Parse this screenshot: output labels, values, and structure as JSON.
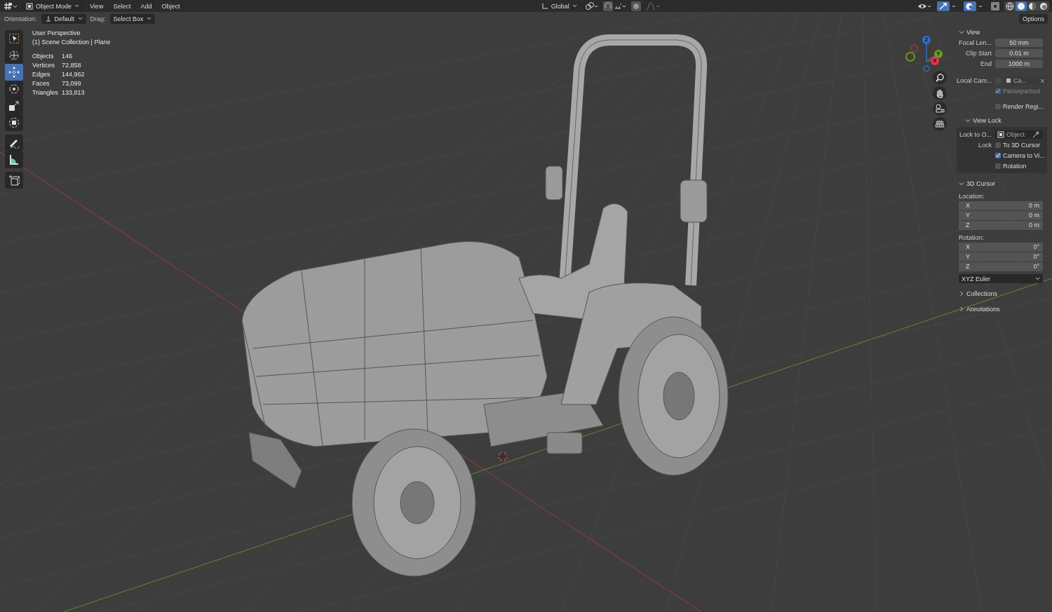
{
  "header": {
    "mode": "Object Mode",
    "menus": [
      "View",
      "Select",
      "Add",
      "Object"
    ],
    "transform_orientation": "Global",
    "shading": [
      {
        "kind": "wireframe",
        "selected": false
      },
      {
        "kind": "solid",
        "selected": true
      },
      {
        "kind": "material",
        "selected": false
      },
      {
        "kind": "rendered",
        "selected": false
      }
    ]
  },
  "tool_settings": {
    "orientation_label": "Orientation:",
    "orientation": "Default",
    "drag_label": "Drag:",
    "drag": "Select Box",
    "options": "Options"
  },
  "toolbar": [
    {
      "kind": "select-box",
      "selected": false
    },
    {
      "kind": "cursor",
      "selected": false
    },
    {
      "kind": "move",
      "selected": true
    },
    {
      "kind": "rotate",
      "selected": false
    },
    {
      "kind": "scale",
      "selected": false
    },
    {
      "kind": "transform",
      "selected": false
    },
    {
      "kind": "annotate",
      "selected": false
    },
    {
      "kind": "measure",
      "selected": false
    },
    {
      "kind": "add-cube",
      "selected": false
    }
  ],
  "viewport_info": {
    "view_name": "User Perspective",
    "collection": "(1) Scene Collection | Plane",
    "stats": [
      {
        "label": "Objects",
        "value": "146"
      },
      {
        "label": "Vertices",
        "value": "72,858"
      },
      {
        "label": "Edges",
        "value": "144,962"
      },
      {
        "label": "Faces",
        "value": "73,099"
      },
      {
        "label": "Triangles",
        "value": "133,813"
      }
    ]
  },
  "gizmo_axes": [
    {
      "label": "Z",
      "color": "#2f6ec4"
    },
    {
      "label": "Y",
      "color": "#6a9a1f"
    },
    {
      "label": "X",
      "color": "#e2354f"
    }
  ],
  "sidebar": {
    "view_panel": {
      "title": "View",
      "expanded": true,
      "fields": [
        {
          "label": "Focal Len...",
          "value": "50 mm"
        },
        {
          "label": "Clip Start",
          "value": "0.01 m"
        },
        {
          "label": "End",
          "value": "1000 m"
        }
      ],
      "local_camera": {
        "label": "Local Cam...",
        "checked": false,
        "placeholder": "Ca..."
      },
      "passepartout": {
        "label": "Passepartout",
        "checked": true
      },
      "render_region": {
        "label": "Render Regi...",
        "checked": false
      },
      "view_lock": {
        "title": "View Lock",
        "expanded": true,
        "lock_object_label": "Lock to O...",
        "lock_object_placeholder": "Object",
        "lock_label": "Lock",
        "options": [
          {
            "label": "To 3D Cursor",
            "checked": false
          },
          {
            "label": "Camera to Vi...",
            "checked": true
          },
          {
            "label": "Rotation",
            "checked": false
          }
        ]
      }
    },
    "cursor_panel": {
      "title": "3D Cursor",
      "expanded": true,
      "location_label": "Location:",
      "location": [
        {
          "axis": "X",
          "value": "0 m"
        },
        {
          "axis": "Y",
          "value": "0 m"
        },
        {
          "axis": "Z",
          "value": "0 m"
        }
      ],
      "rotation_label": "Rotation:",
      "rotation": [
        {
          "axis": "X",
          "value": "0°"
        },
        {
          "axis": "Y",
          "value": "0°"
        },
        {
          "axis": "Z",
          "value": "0°"
        }
      ],
      "rotation_mode": "XYZ Euler"
    },
    "collapsed_panels": [
      {
        "title": "Collections",
        "expanded": false
      },
      {
        "title": "Annotations",
        "expanded": false
      }
    ]
  }
}
